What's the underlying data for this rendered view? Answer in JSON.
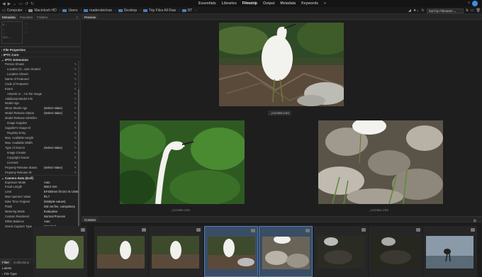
{
  "workspaces": [
    "Essentials",
    "Libraries",
    "Filmstrip",
    "Output",
    "Metadata",
    "Keywords"
  ],
  "active_workspace": "Filmstrip",
  "breadcrumbs": [
    "Computer",
    "Macintosh HD",
    "Users",
    "readenderlose",
    "Desktop",
    "Trip Files All Raw",
    "BT"
  ],
  "sort_label": "Sort by Filename",
  "left_tabs": [
    "Metadata",
    "Favorites",
    "Folders"
  ],
  "meta_mini": {
    "fstop": "f/ --",
    "dash1": "--",
    "dash2": "--",
    "dash3": "--",
    "iso": "ISO --",
    "dash4": "--",
    "dash5": "--"
  },
  "sections": {
    "file_properties": "File Properties",
    "iptc_core": "IPTC Core",
    "iptc_extension": "IPTC Extension",
    "camera_data": "Camera Data (Exif)"
  },
  "iptc_rows": [
    {
      "label": "Person Shown",
      "value": ""
    },
    {
      "label": "Location (h...was created",
      "value": ""
    },
    {
      "label": "Location Shown",
      "value": ""
    },
    {
      "label": "Name of Featured",
      "value": ""
    },
    {
      "label": "Code of Featured",
      "value": ""
    },
    {
      "label": "Event",
      "value": ""
    },
    {
      "label": "Artwork or ...t in the Image",
      "value": ""
    },
    {
      "label": "Additional Model Info",
      "value": ""
    },
    {
      "label": "Model Age",
      "value": ""
    },
    {
      "label": "Minor Model Age",
      "value": "(Select Value)"
    },
    {
      "label": "Model Release Status",
      "value": "(Select Value)"
    },
    {
      "label": "Model Release Identifier",
      "value": ""
    },
    {
      "label": "Image Supplier",
      "value": ""
    },
    {
      "label": "Supplier's Image ID",
      "value": ""
    },
    {
      "label": "Registry Entry",
      "value": ""
    },
    {
      "label": "Max. Available Height",
      "value": ""
    },
    {
      "label": "Max. Available Width",
      "value": ""
    },
    {
      "label": "Type of Source",
      "value": "(Select Value)"
    },
    {
      "label": "Image Creator",
      "value": ""
    },
    {
      "label": "Copyright Owner",
      "value": ""
    },
    {
      "label": "Licensor",
      "value": ""
    },
    {
      "label": "Property Release Status",
      "value": "(Select Value)"
    },
    {
      "label": "Property Release ID",
      "value": ""
    }
  ],
  "camera_rows": [
    {
      "label": "Exposure Mode",
      "value": "Auto"
    },
    {
      "label": "Focal Length",
      "value": "560.0 mm"
    },
    {
      "label": "Lens",
      "value": "EF400mm f/4 DO IS USM"
    },
    {
      "label": "Max Aperture Value",
      "value": "f/5.7"
    },
    {
      "label": "Date Time Original",
      "value": "(Multiple values)"
    },
    {
      "label": "Flash",
      "value": "Did not fire, compulsory"
    },
    {
      "label": "Metering Mode",
      "value": "Evaluative"
    },
    {
      "label": "Custom Rendered",
      "value": "Normal Process"
    },
    {
      "label": "White Balance",
      "value": "Auto"
    },
    {
      "label": "Scene Capture Type",
      "value": "Standard"
    }
  ],
  "filter_tabs": [
    "Filter",
    "Collections"
  ],
  "filter_rows": [
    "Labels",
    "File Type"
  ],
  "preview_tab": "Preview",
  "content_tab": "Content",
  "captions": {
    "top": "_IO27899.CR3",
    "left": "_IO27890.CR3",
    "right": "_IO27891.CR3"
  },
  "colors": {
    "accent": "#4f7fc0",
    "avatar": "#3a8ee6",
    "folder": "#4a7eb5"
  },
  "icons": [
    "back-icon",
    "forward-icon",
    "undo-icon",
    "redo-icon",
    "folder-icon",
    "pencil-icon",
    "grid-icon",
    "menu-icon",
    "user-avatar-icon"
  ]
}
